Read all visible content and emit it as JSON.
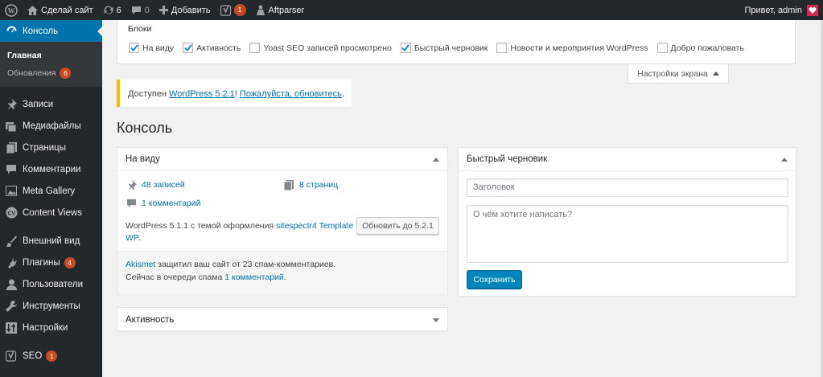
{
  "adminbar": {
    "site_name": "Сделай сайт",
    "updates_count": "6",
    "comments_count": "0",
    "new_label": "Добавить",
    "seo_count": "1",
    "plugin_label": "Aftparser",
    "greeting": "Привет, admin"
  },
  "sidebar": {
    "dashboard": "Консоль",
    "sub_home": "Главная",
    "sub_updates": "Обновления",
    "sub_updates_count": "6",
    "posts": "Записи",
    "media": "Медиафайлы",
    "pages": "Страницы",
    "comments": "Комментарии",
    "meta_gallery": "Meta Gallery",
    "content_views": "Content Views",
    "appearance": "Внешний вид",
    "plugins": "Плагины",
    "plugins_count": "4",
    "users": "Пользователи",
    "tools": "Инструменты",
    "settings": "Настройки",
    "seo": "SEO",
    "seo_count": "1"
  },
  "screen_options": {
    "heading": "Блоки",
    "checkboxes": [
      {
        "label": "На виду",
        "checked": true
      },
      {
        "label": "Активность",
        "checked": true
      },
      {
        "label": "Yoast SEO записей просмотрено",
        "checked": false
      },
      {
        "label": "Быстрый черновик",
        "checked": true
      },
      {
        "label": "Новости и мероприятия WordPress",
        "checked": false
      },
      {
        "label": "Добро пожаловать",
        "checked": false
      }
    ],
    "tab_label": "Настройки экрана"
  },
  "notice": {
    "prefix": "Доступен ",
    "version_link": "WordPress 5.2.1",
    "middle": "! ",
    "update_link": "Пожалуйста, обновитесь",
    "suffix": "."
  },
  "page_title": "Консоль",
  "glance": {
    "title": "На виду",
    "posts": "48 записей",
    "pages": "8 страниц",
    "comments": "1 комментарий",
    "version_text": "WordPress 5.1.1 с темой оформления ",
    "theme_link": "sitespectr4 Template WP",
    "version_end": ".",
    "update_button": "Обновить до 5.2.1",
    "akismet_link": "Akismet",
    "akismet_text": " защитил ваш сайт от 23 спам-комментариев.",
    "queue_text": "Сейчас в очереди спама ",
    "queue_link": "1 комментарий",
    "queue_end": "."
  },
  "draft": {
    "title": "Быстрый черновик",
    "title_placeholder": "Заголовок",
    "content_placeholder": "О чём хотите написать?",
    "save_button": "Сохранить"
  },
  "activity": {
    "title": "Активность"
  },
  "colors": {
    "accent": "#0073aa",
    "adminbar": "#23282d",
    "badge": "#ca4a1f",
    "notice_border": "#ffb900"
  }
}
